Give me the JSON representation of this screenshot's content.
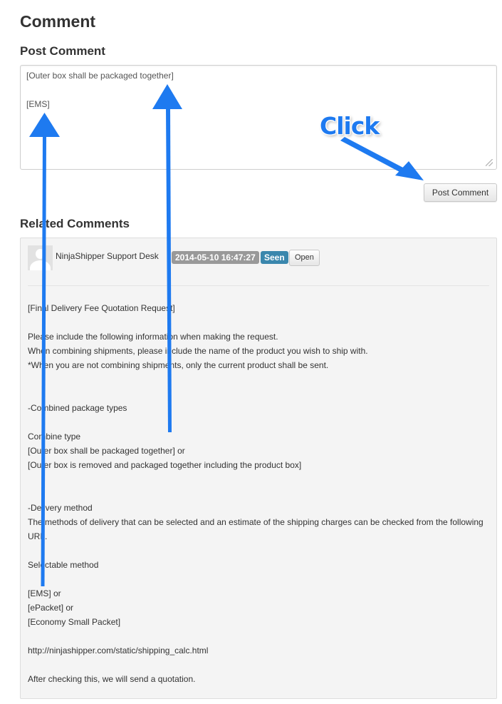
{
  "page": {
    "title": "Comment",
    "post_section_title": "Post Comment",
    "related_section_title": "Related Comments"
  },
  "compose": {
    "value_line1": "[Outer box shall be packaged together]",
    "value_line2": "[EMS]",
    "submit_label": "Post Comment"
  },
  "comment": {
    "author": "NinjaShipper Support Desk",
    "date": "2014-05-10 16:47:27",
    "seen_label": "Seen",
    "open_label": "Open",
    "body_lines": [
      "[Final Delivery Fee Quotation Request]",
      "",
      "Please include the following information when making the request.",
      "When combining shipments, please include the name of the product you wish to ship with.",
      "*When you are not combining shipments, only the current product shall be sent.",
      "",
      "",
      "-Combined package types",
      "",
      "Combine type",
      "[Outer box shall be packaged together] or",
      "[Outer box is removed and packaged together including the product box]",
      "",
      "",
      "-Delivery method",
      "The methods of delivery that can be selected and an estimate of the shipping charges can be checked from the following URL.",
      "",
      "Selectable method",
      "",
      "[EMS] or",
      "[ePacket] or",
      "[Economy Small Packet]",
      "",
      "http://ninjashipper.com/static/shipping_calc.html",
      "",
      "After checking this, we will send a quotation."
    ]
  },
  "annotation": {
    "click_label": "Click",
    "arrow_color": "#1e7af0"
  },
  "colors": {
    "seen_badge": "#3a87ad",
    "date_badge": "#999999"
  }
}
